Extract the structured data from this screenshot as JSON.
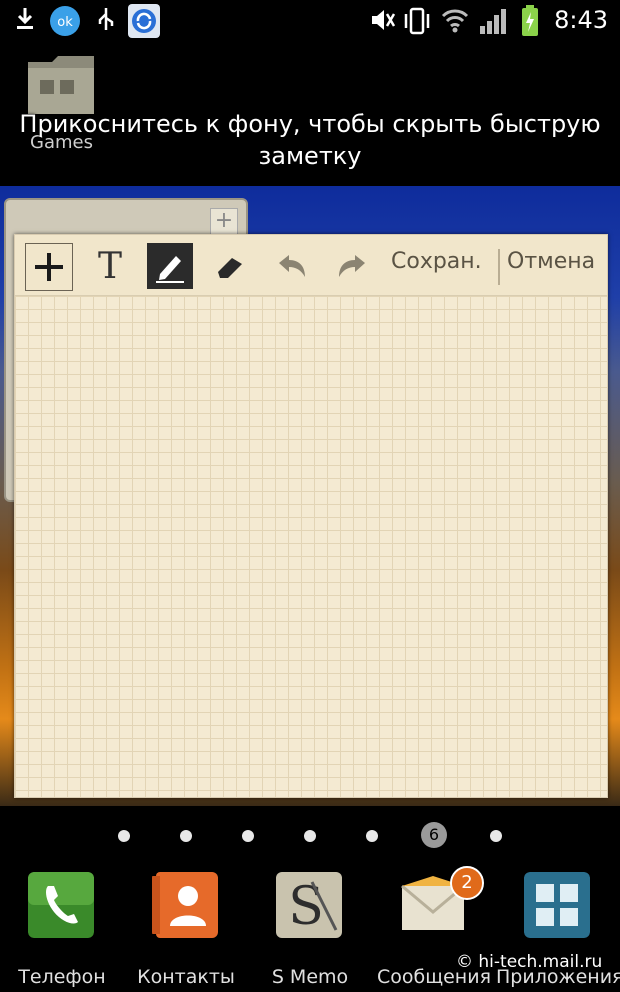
{
  "status_bar": {
    "time": "8:43",
    "icons": [
      "download-icon",
      "ok-app-icon",
      "usb-icon",
      "sync-icon",
      "mute-icon",
      "vibrate-icon",
      "wifi-icon",
      "signal-icon",
      "battery-icon"
    ]
  },
  "desktop": {
    "folder_label": "Games",
    "hint_line1": "Прикоснитесь к фону, чтобы скрыть быструю",
    "hint_line2": "заметку"
  },
  "memo": {
    "toolbar": {
      "tools": [
        "plus-icon",
        "text-tool-icon",
        "pen-tool-icon",
        "eraser-icon",
        "undo-icon",
        "redo-icon"
      ],
      "text_tool_label": "T",
      "save_label": "Сохран.",
      "cancel_label": "Отмена"
    }
  },
  "pages": {
    "current_number": "6"
  },
  "dock": {
    "items": [
      {
        "label": "Телефон"
      },
      {
        "label": "Контакты"
      },
      {
        "label": "S Memo"
      },
      {
        "label": "Сообщения",
        "badge": "2"
      },
      {
        "label": "Приложения"
      }
    ]
  },
  "watermark": "© hi-tech.mail.ru",
  "colors": {
    "memo_paper": "#f4ead2",
    "grid_line": "#e2d4b5",
    "badge": "#e06a1a"
  }
}
